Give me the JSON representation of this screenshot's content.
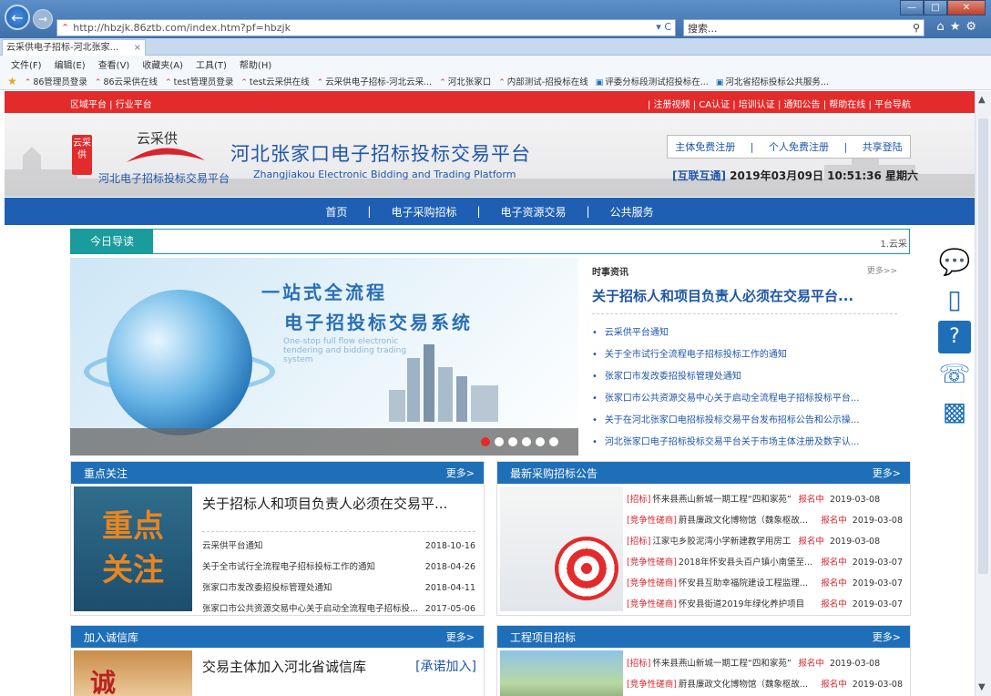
{
  "browser": {
    "url": "http://hbzjk.86ztb.com/index.htm?pf=hbzjk",
    "search_placeholder": "搜索...",
    "tab_title": "云采供电子招标-河北张家...",
    "window_buttons": [
      "—",
      "□",
      "✕"
    ],
    "menu": [
      "文件(F)",
      "编辑(E)",
      "查看(V)",
      "收藏夹(A)",
      "工具(T)",
      "帮助(H)"
    ],
    "favorites": [
      "86管理员登录",
      "86云采供在线",
      "test管理员登录",
      "test云采供在线",
      "云采供电子招标-河北云采...",
      "河北张家口",
      "内部测试-招投标在线",
      "评委分标段测试招投标在...",
      "河北省招标投标公共服务..."
    ]
  },
  "topbar": {
    "left": "区域平台 | 行业平台",
    "right": "| 注册视频 | CA认证 | 培训认证 | 通知公告 | 帮助在线 | 平台导航"
  },
  "header": {
    "logo_seal": "云采供",
    "logo_brand": "云采供",
    "logo_sub": "河北电子招标投标交易平台",
    "title": "河北张家口电子招标投标交易平台",
    "title_en": "Zhangjiakou Electronic Bidding and Trading Platform",
    "register_links": [
      "主体免费注册",
      "|",
      "个人免费注册",
      "|",
      "共享登陆"
    ],
    "clock_label": "[互联互通]",
    "clock_text": "2019年03月09日 10:51:36 星期六"
  },
  "nav": [
    "首页",
    "|",
    "电子采购招标",
    "|",
    "电子资源交易",
    "|",
    "公共服务"
  ],
  "guide": {
    "label": "今日导读",
    "marquee": "1.云采"
  },
  "banner": {
    "line1": "一站式全流程",
    "line2": "电子招投标交易系统",
    "english": "One-stop full flow electronic tendering and bidding trading system",
    "slides": 6,
    "active_slide": 0
  },
  "news": {
    "heading": "时事资讯",
    "more": "更多>>",
    "headline": "关于招标人和项目负责人必须在交易平台...",
    "items": [
      "云采供平台通知",
      "关于全市试行全流程电子招标投标工作的通知",
      "张家口市发改委招投标管理处通知",
      "张家口市公共资源交易中心关于启动全流程电子招标投标平台...",
      "关于在河北张家口电招标投标交易平台发布招标公告和公示操...",
      "河北张家口电子招标投标交易平台关于市场主体注册及数字认..."
    ]
  },
  "focus": {
    "title": "重点关注",
    "more": "更多>",
    "image_text": [
      "重点",
      "关注"
    ],
    "headline": "关于招标人和项目负责人必须在交易平...",
    "items": [
      {
        "text": "云采供平台通知",
        "date": "2018-10-16"
      },
      {
        "text": "关于全市试行全流程电子招标投标工作的通知",
        "date": "2018-04-26"
      },
      {
        "text": "张家口市发改委招投标管理处通知",
        "date": "2018-04-11"
      },
      {
        "text": "张家口市公共资源交易中心关于启动全流程电子招标投...",
        "date": "2017-05-06"
      }
    ]
  },
  "bids": {
    "title": "最新采购招标公告",
    "more": "更多>",
    "items": [
      {
        "tag": "[招标]",
        "name": "怀来县燕山新城一期工程“四和家苑”...",
        "status": "报名中",
        "date": "2019-03-08"
      },
      {
        "tag": "[竞争性磋商]",
        "name": "蔚县廉政文化博物馆（魏象枢故...",
        "status": "报名中",
        "date": "2019-03-08"
      },
      {
        "tag": "[招标]",
        "name": "江家屯乡胶泥湾小学新建教学用房工程",
        "status": "报名中",
        "date": "2019-03-08"
      },
      {
        "tag": "[竞争性磋商]",
        "name": "2018年怀安县头百户镇小南堡至...",
        "status": "报名中",
        "date": "2019-03-07"
      },
      {
        "tag": "[竞争性磋商]",
        "name": "怀安县互助幸福院建设工程监理...",
        "status": "报名中",
        "date": "2019-03-07"
      },
      {
        "tag": "[竞争性磋商]",
        "name": "怀安县街道2019年绿化养护项目",
        "status": "报名中",
        "date": "2019-03-07"
      }
    ]
  },
  "credit": {
    "title": "加入诚信库",
    "more": "更多>",
    "image_text": "诚",
    "headline": "交易主体加入河北省诚信库",
    "link": "[承诺加入]"
  },
  "projects": {
    "title": "工程项目招标",
    "more": "更多>",
    "items": [
      {
        "tag": "[招标]",
        "name": "怀来县燕山新城一期工程“四和家苑”...",
        "status": "报名中",
        "date": "2019-03-08"
      },
      {
        "tag": "[竞争性磋商]",
        "name": "蔚县廉政文化博物馆（魏象枢故...",
        "status": "报名中",
        "date": "2019-03-08"
      }
    ]
  },
  "side_icons": [
    "chat-icon",
    "app-icon",
    "help-icon",
    "phone-icon",
    "chart-icon"
  ]
}
